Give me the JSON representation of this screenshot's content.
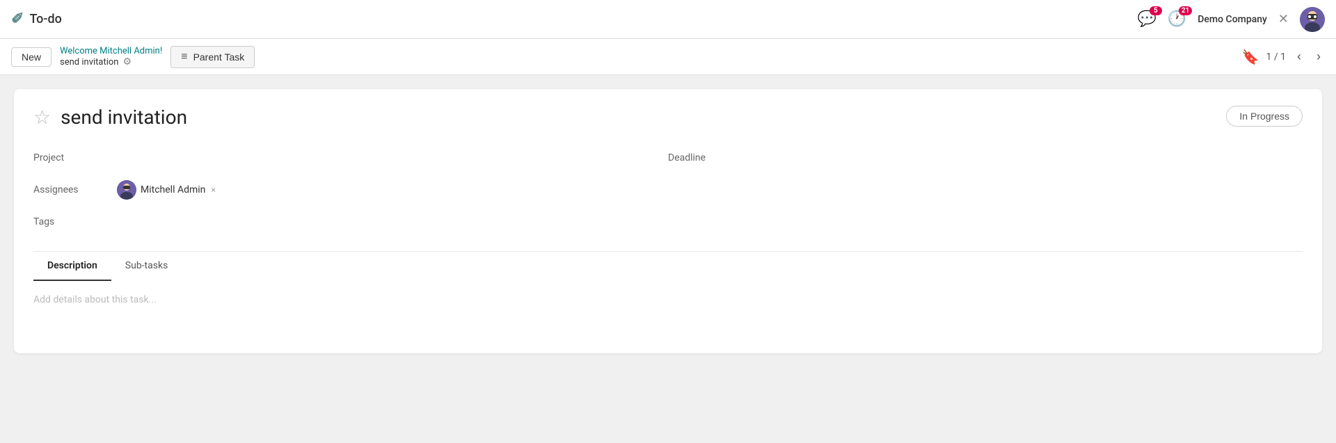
{
  "app": {
    "title": "To-do",
    "icon": "✏️"
  },
  "topbar": {
    "notifications_count": "5",
    "clock_count": "21",
    "company": "Demo Company",
    "close_label": "✕"
  },
  "toolbar": {
    "new_button": "New",
    "breadcrumb_link": "Welcome Mitchell Admin!",
    "breadcrumb_sub": "send invitation",
    "gear_label": "⚙",
    "parent_task_label": "Parent Task",
    "pagination": "1 / 1"
  },
  "task": {
    "title": "send invitation",
    "status": "In Progress",
    "star": "☆",
    "fields": {
      "project_label": "Project",
      "deadline_label": "Deadline",
      "assignees_label": "Assignees",
      "assignee_name": "Mitchell Admin",
      "remove_symbol": "×",
      "tags_label": "Tags"
    },
    "tabs": [
      {
        "id": "description",
        "label": "Description",
        "active": true
      },
      {
        "id": "subtasks",
        "label": "Sub-tasks",
        "active": false
      }
    ],
    "description_placeholder": "Add details about this task..."
  }
}
